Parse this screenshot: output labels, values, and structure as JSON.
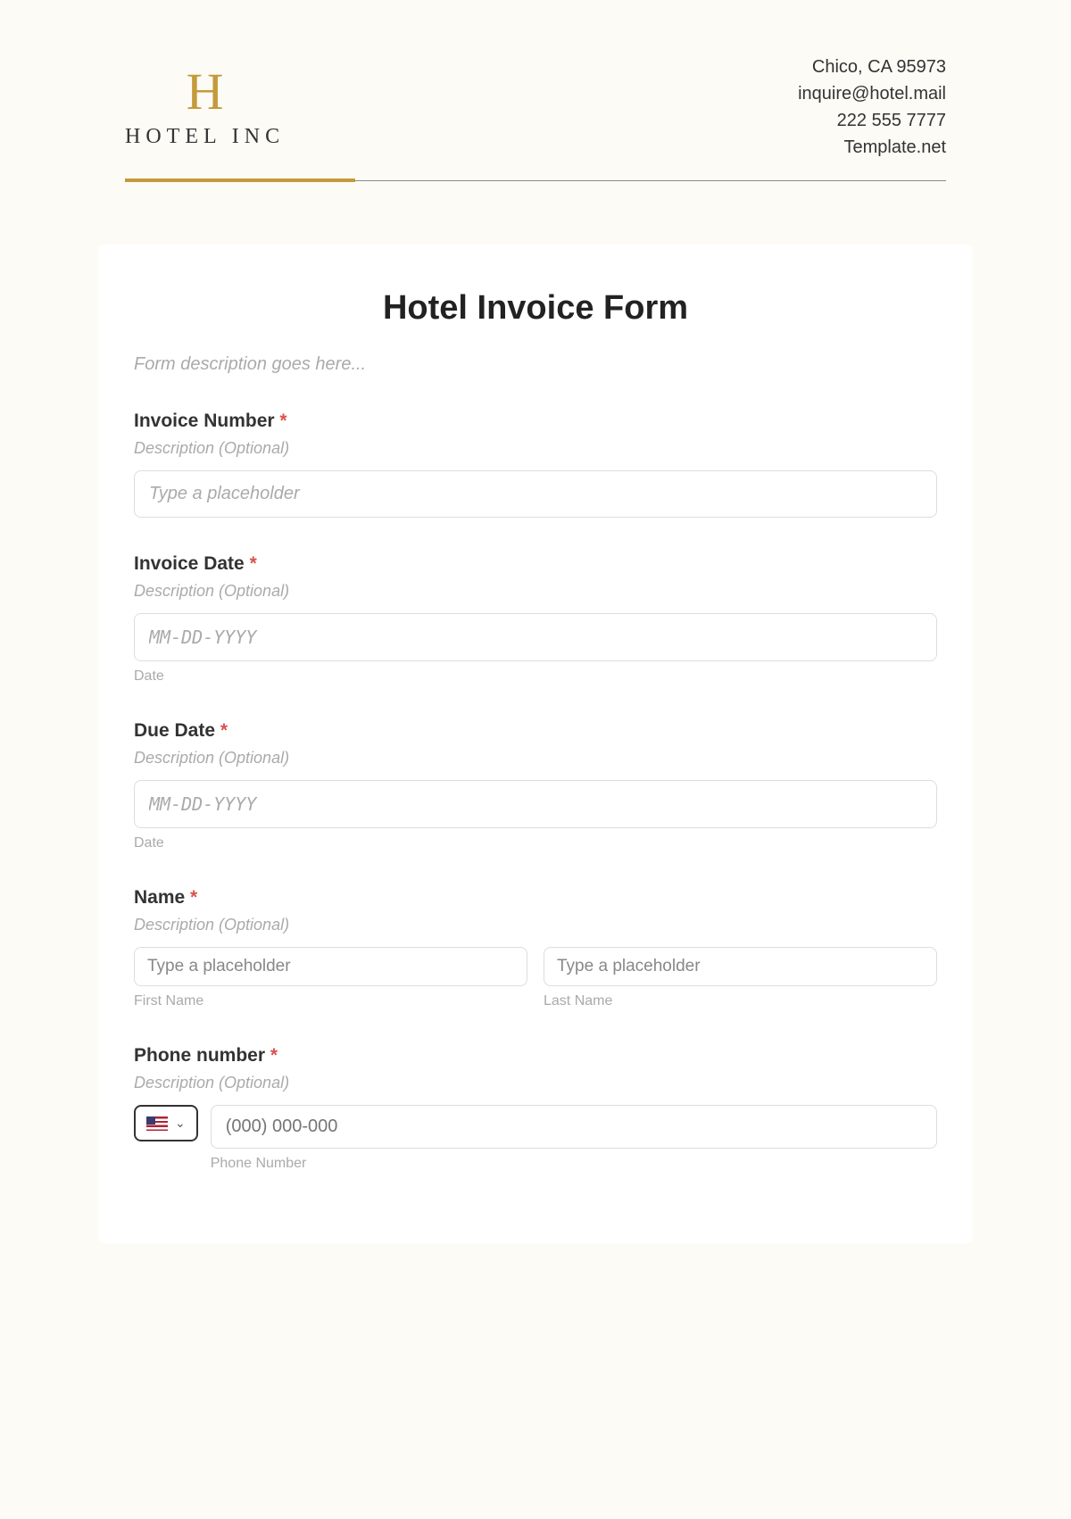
{
  "header": {
    "logo_letter": "H",
    "logo_text": "HOTEL INC",
    "contact": {
      "address": "Chico, CA 95973",
      "email": "inquire@hotel.mail",
      "phone": "222 555 7777",
      "site": "Template.net"
    }
  },
  "form": {
    "title": "Hotel Invoice Form",
    "description": "Form description goes here...",
    "fields": {
      "invoice_number": {
        "label": "Invoice Number",
        "desc": "Description (Optional)",
        "placeholder": "Type a placeholder"
      },
      "invoice_date": {
        "label": "Invoice Date",
        "desc": "Description (Optional)",
        "placeholder": "MM-DD-YYYY",
        "sub": "Date"
      },
      "due_date": {
        "label": "Due Date",
        "desc": "Description (Optional)",
        "placeholder": "MM-DD-YYYY",
        "sub": "Date"
      },
      "name": {
        "label": "Name",
        "desc": "Description (Optional)",
        "first_placeholder": "Type a placeholder",
        "first_sub": "First Name",
        "last_placeholder": "Type a placeholder",
        "last_sub": "Last Name"
      },
      "phone": {
        "label": "Phone number",
        "desc": "Description (Optional)",
        "placeholder": "(000) 000-000",
        "sub": "Phone Number"
      }
    },
    "required_mark": "*"
  }
}
